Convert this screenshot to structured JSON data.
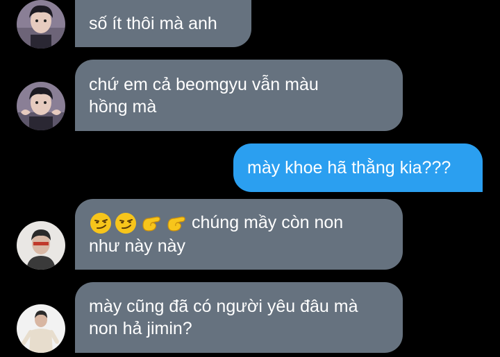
{
  "messages": [
    {
      "side": "incoming",
      "lines": [
        "số ít thôi mà anh"
      ],
      "avatar_icon": "user-avatar-1"
    },
    {
      "side": "incoming",
      "lines": [
        "chứ em cả beomgyu vẫn màu",
        "hồng mà"
      ],
      "avatar_icon": "user-avatar-1"
    },
    {
      "side": "outgoing",
      "lines": [
        "mày khoe hã thằng kia???"
      ]
    },
    {
      "side": "incoming",
      "emojis": [
        "smirking-face-emoji",
        "smirking-face-emoji",
        "pinching-hand-emoji",
        "pinching-hand-emoji"
      ],
      "lines": [
        "chúng mầy còn non",
        "như này này"
      ],
      "avatar_icon": "user-avatar-2"
    },
    {
      "side": "incoming",
      "lines": [
        "mày cũng đã có người yêu đâu mà",
        "non hả jimin?"
      ],
      "avatar_icon": "user-avatar-3"
    }
  ],
  "colors": {
    "background": "#000000",
    "incoming_bubble": "#66727f",
    "outgoing_bubble": "#2b9ff0",
    "text": "#ffffff"
  }
}
